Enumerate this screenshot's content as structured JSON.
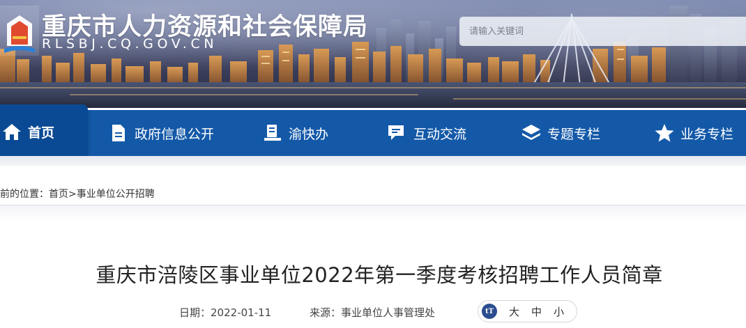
{
  "header": {
    "site_title": "重庆市人力资源和社会保障局",
    "site_domain": "RLSBJ.CQ.GOV.CN",
    "search_placeholder": "请输入关键词"
  },
  "nav": {
    "items": [
      {
        "label": "首页",
        "icon": "home-icon",
        "active": true
      },
      {
        "label": "政府信息公开",
        "icon": "document-icon"
      },
      {
        "label": "渝快办",
        "icon": "reader-icon"
      },
      {
        "label": "互动交流",
        "icon": "chat-icon"
      },
      {
        "label": "专题专栏",
        "icon": "layers-icon"
      },
      {
        "label": "业务专栏",
        "icon": "star-icon"
      }
    ]
  },
  "breadcrumb": {
    "prefix": "前的位置：",
    "home": "首页",
    "separator": ">",
    "current": "事业单位公开招聘"
  },
  "article": {
    "title": "重庆市涪陵区事业单位2022年第一季度考核招聘工作人员简章",
    "date_label": "日期：",
    "date": "2022-01-11",
    "source_label": "来源：",
    "source": "事业单位人事管理处"
  },
  "font_size": {
    "icon": "font-size-icon",
    "icon_text": "tT",
    "options": [
      "大",
      "中",
      "小"
    ]
  },
  "colors": {
    "nav_bg": "#1459a8",
    "nav_active_bg": "#0a4a94",
    "font_icon_bg": "#2b4d8f"
  }
}
